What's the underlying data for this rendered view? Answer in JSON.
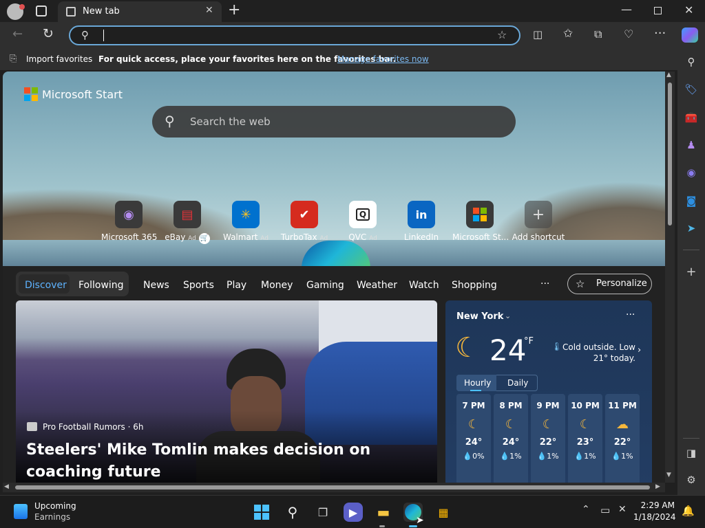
{
  "browser": {
    "tab_title": "New tab",
    "address_value": "",
    "favorites_bar": {
      "import_label": "Import favorites",
      "message": "For quick access, place your favorites here on the favorites bar.",
      "manage_link": "Manage favorites now"
    }
  },
  "page": {
    "brand": "Microsoft Start",
    "search_placeholder": "Search the web",
    "shortcuts": [
      {
        "label": "Microsoft 365",
        "ad": ""
      },
      {
        "label": "eBay",
        "ad": "Ad"
      },
      {
        "label": "Walmart",
        "ad": "Ad"
      },
      {
        "label": "TurboTax",
        "ad": "Ad"
      },
      {
        "label": "QVC",
        "ad": "Ad"
      },
      {
        "label": "LinkedIn",
        "ad": ""
      },
      {
        "label": "Microsoft St...",
        "ad": ""
      },
      {
        "label": "Add shortcut",
        "ad": ""
      }
    ],
    "feed_nav": {
      "discover": "Discover",
      "following": "Following",
      "items": [
        "News",
        "Sports",
        "Play",
        "Money",
        "Gaming",
        "Weather",
        "Watch",
        "Shopping"
      ],
      "more": "···",
      "personalize": "Personalize"
    },
    "hero": {
      "source": "Pro Football Rumors · 6h",
      "headline": "Steelers' Mike Tomlin makes decision on coaching future"
    },
    "weather": {
      "location": "New York",
      "temp": "24",
      "unit": "°F",
      "note": "Cold outside. Low 21° today.",
      "tabs": [
        "Hourly",
        "Daily"
      ],
      "hours": [
        {
          "time": "7 PM",
          "temp": "24°",
          "precip": "0%"
        },
        {
          "time": "8 PM",
          "temp": "24°",
          "precip": "1%"
        },
        {
          "time": "9 PM",
          "temp": "22°",
          "precip": "1%"
        },
        {
          "time": "10 PM",
          "temp": "23°",
          "precip": "1%"
        },
        {
          "time": "11 PM",
          "temp": "22°",
          "precip": "1%"
        }
      ]
    }
  },
  "taskbar": {
    "widget_title": "Upcoming",
    "widget_sub": "Earnings",
    "time": "2:29 AM",
    "date": "1/18/2024"
  },
  "colors": {
    "accent": "#4cc2ff",
    "link": "#7bb8f0",
    "chrome": "#2f2f2f"
  }
}
